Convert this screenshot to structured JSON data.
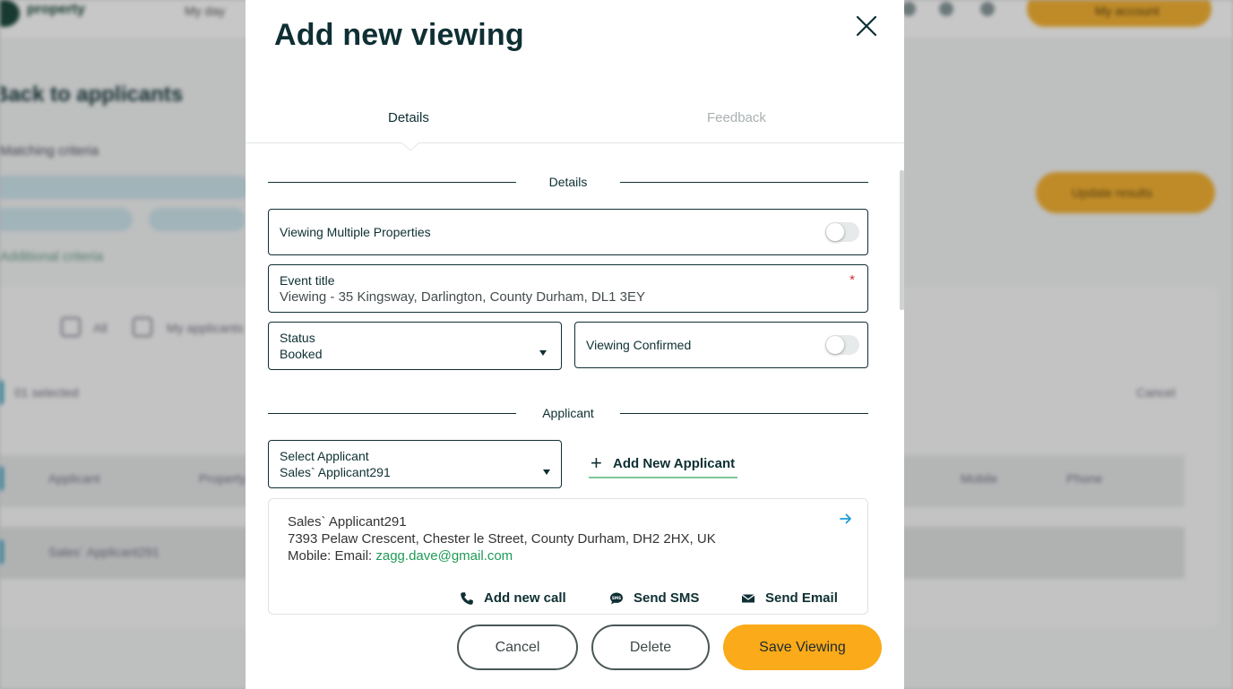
{
  "background": {
    "logo_text": "property",
    "nav_item": "My day",
    "account_button": "My account",
    "back_link": "Back to applicants",
    "criteria_label": "Matching criteria",
    "additional_criteria": "Additional criteria",
    "update_button": "Update results",
    "filter_all": "All",
    "filter_my": "My applicants",
    "selected_count": "01 selected",
    "cancel_link": "Cancel",
    "columns": [
      "Applicant",
      "Property",
      "Mobile",
      "Phone"
    ],
    "row_applicant": "Sales` Applicant291"
  },
  "modal": {
    "title": "Add new viewing",
    "tabs": [
      {
        "label": "Details",
        "active": true
      },
      {
        "label": "Feedback",
        "active": false
      }
    ],
    "details_section": "Details",
    "viewing_multiple_label": "Viewing Multiple Properties",
    "viewing_multiple_on": false,
    "event_title_label": "Event title",
    "event_title_value": "Viewing - 35 Kingsway, Darlington, County Durham, DL1 3EY",
    "required_mark": "*",
    "status_label": "Status",
    "status_value": "Booked",
    "viewing_confirmed_label": "Viewing Confirmed",
    "viewing_confirmed_on": false,
    "applicant_section": "Applicant",
    "select_applicant_label": "Select Applicant",
    "select_applicant_value": "Sales` Applicant291",
    "add_new_applicant": "Add New Applicant",
    "card": {
      "name": "Sales` Applicant291",
      "address": "7393 Pelaw Crescent, Chester le Street, County Durham, DH2 2HX, UK",
      "contact_prefix": "Mobile: Email: ",
      "email": "zagg.dave@gmail.com",
      "actions": {
        "add_call": "Add new call",
        "send_sms": "Send SMS",
        "send_email": "Send Email"
      }
    },
    "buttons": {
      "cancel": "Cancel",
      "delete": "Delete",
      "save": "Save Viewing"
    }
  },
  "colors": {
    "primary_text": "#0e2f33",
    "save_button": "#fbaa1a",
    "email_link": "#1f9b57",
    "accent_underline": "#7cc89a",
    "arrow_link": "#1e9ad6",
    "required": "#d32f2f"
  }
}
